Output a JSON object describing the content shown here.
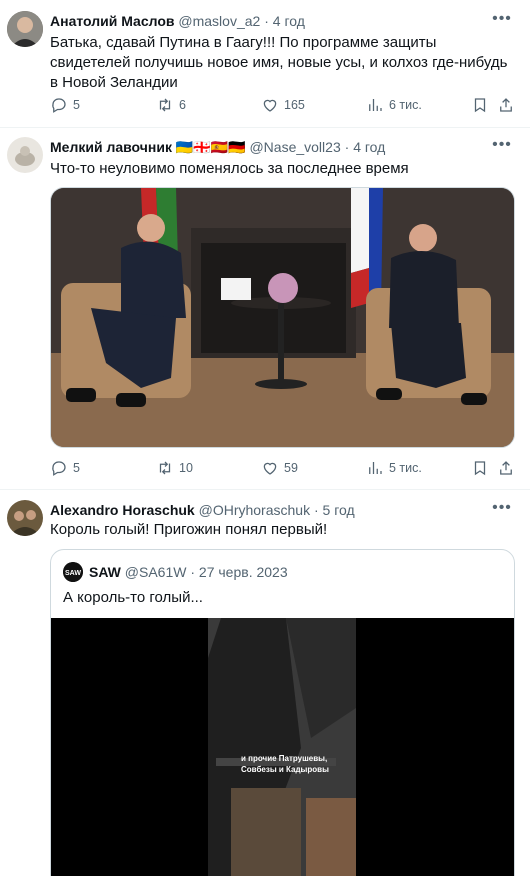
{
  "tweets": [
    {
      "author_name": "Анатолий Маслов",
      "handle": "@maslov_a2",
      "separator": "·",
      "time": "4 год",
      "text": "Батька, сдавай Путина в Гаагу!!! По программе защиты свидетелей получишь новое имя, новые усы, и колхоз где-нибудь в Новой Зеландии",
      "stats": {
        "replies": "5",
        "retweets": "6",
        "likes": "165",
        "views": "6 тис."
      }
    },
    {
      "author_name": "Мелкий лавочник",
      "flags": "🇺🇦🇬🇪🇪🇸🇩🇪",
      "handle": "@Nase_voll23",
      "separator": "·",
      "time": "4 год",
      "text": "Что-то неуловимо поменялось за последнее время",
      "stats": {
        "replies": "5",
        "retweets": "10",
        "likes": "59",
        "views": "5 тис."
      }
    },
    {
      "author_name": "Alexandro Horaschuk",
      "handle": "@OHryhoraschuk",
      "separator": "·",
      "time": "5 год",
      "text": "Король голый! Пригожин понял первый!",
      "quote": {
        "author_name": "SAW",
        "avatar_text": "SAW",
        "handle": "@SA61W",
        "separator": "·",
        "time": "27 черв. 2023",
        "text": "А король-то голый...",
        "caption_line1": "и прочие Патрушевы,",
        "caption_line2": "Совбезы и Кадыровы"
      }
    }
  ],
  "icons": [
    "reply-icon",
    "retweet-icon",
    "like-icon",
    "views-icon",
    "bookmark-icon",
    "share-icon",
    "more-icon"
  ],
  "colors": {
    "text": "#0f1419",
    "secondary": "#536471",
    "border": "#eff3f4",
    "media_border": "#cfd9de"
  }
}
